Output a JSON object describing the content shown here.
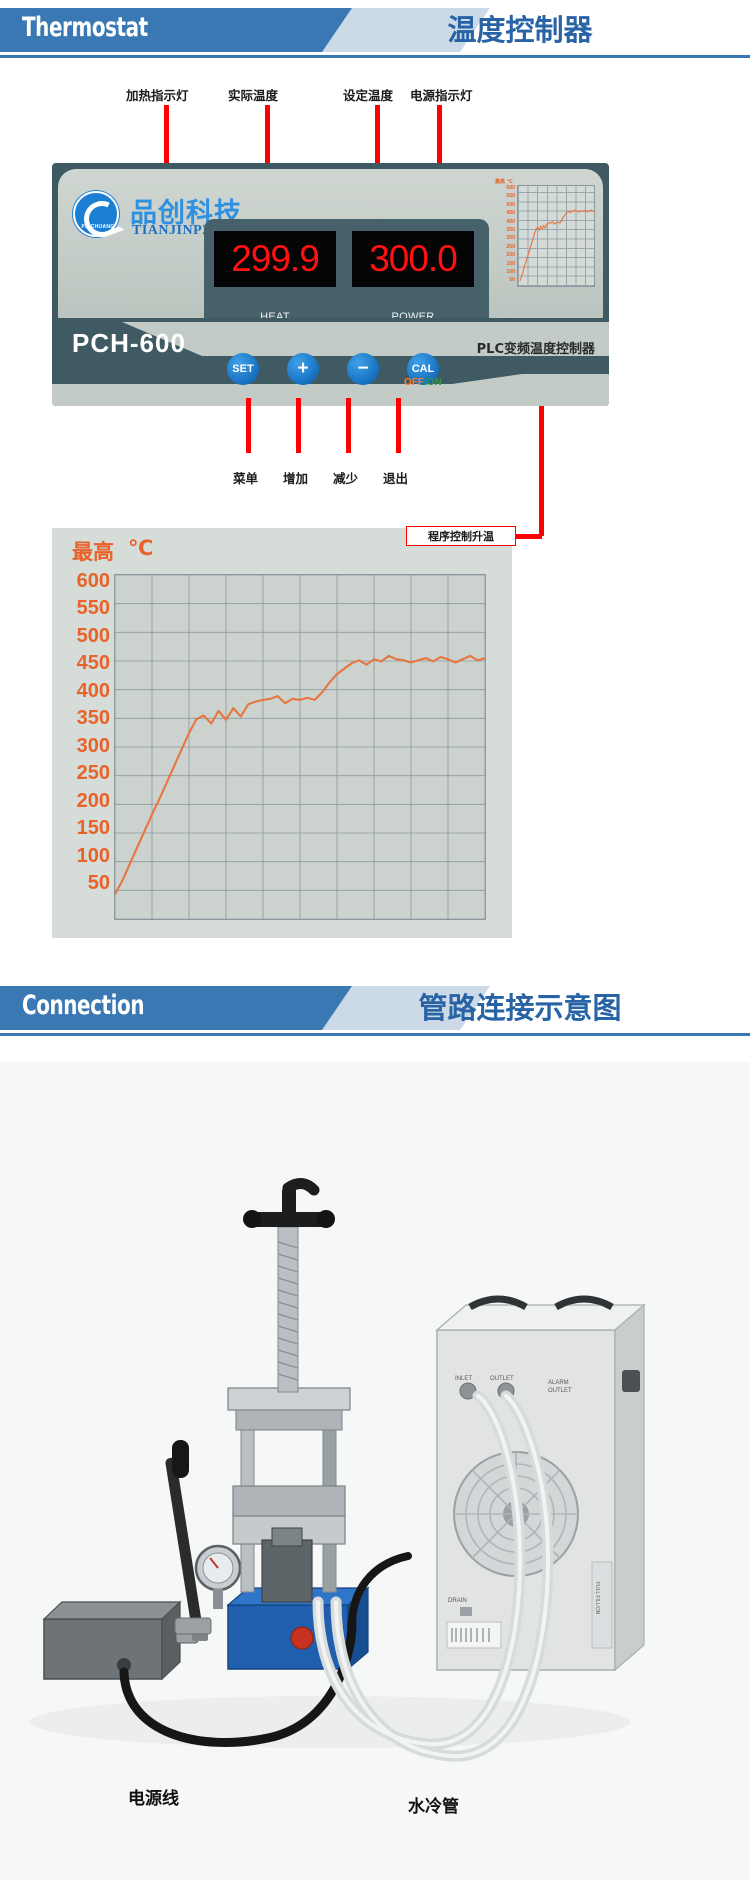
{
  "sections": [
    {
      "id": "thermostat",
      "en_title": "Thermostat",
      "cn_title": "温度控制器"
    },
    {
      "id": "connection",
      "en_title": "Connection",
      "cn_title": "管路连接示意图"
    }
  ],
  "top_callouts": [
    {
      "label": "加热指示灯"
    },
    {
      "label": "实际温度"
    },
    {
      "label": "设定温度"
    },
    {
      "label": "电源指示灯"
    }
  ],
  "bottom_callouts": [
    {
      "label": "菜单"
    },
    {
      "label": "增加"
    },
    {
      "label": "减少"
    },
    {
      "label": "退出"
    }
  ],
  "controller": {
    "brand_cn": "品创科技",
    "brand_domain": "TIANJINPZ.COM",
    "logo_text": "PINCHUANG",
    "model": "PCH-600",
    "tagline": "PLC变频温度控制器",
    "displays": [
      {
        "value": "299.9",
        "label": "HEAT"
      },
      {
        "value": "300.0",
        "label": "POWER"
      }
    ],
    "buttons": [
      {
        "label": "SET"
      },
      {
        "label": "+"
      },
      {
        "label": "−"
      },
      {
        "label": "CAL"
      }
    ],
    "power_switch": {
      "off": "OFF",
      "slash": "/",
      "on": "ON"
    },
    "mini_chart": {
      "title": "最高 ℃",
      "ticks": [
        "600",
        "550",
        "500",
        "450",
        "400",
        "350",
        "300",
        "250",
        "200",
        "150",
        "100",
        "50"
      ]
    }
  },
  "big_chart": {
    "callout": "程序控制升温",
    "title": "最高",
    "unit": "℃"
  },
  "chart_data": {
    "type": "line",
    "title": "最高 ℃",
    "xlabel": "",
    "ylabel": "℃",
    "ylim": [
      0,
      625
    ],
    "yticks": [
      600,
      550,
      500,
      450,
      400,
      350,
      300,
      250,
      200,
      150,
      100,
      50
    ],
    "ytick_labels": [
      "600",
      "550",
      "500",
      "450",
      "400",
      "350",
      "300",
      "250",
      "200",
      "150",
      "100",
      "50"
    ],
    "grid": true,
    "legend": "none",
    "line_color": "#e8743f",
    "series": [
      {
        "name": "程序控制升温",
        "x": [
          0,
          2,
          4,
          6,
          8,
          10,
          12,
          14,
          16,
          18,
          20,
          22,
          24,
          26,
          28,
          30,
          32,
          34,
          36,
          38,
          40,
          42,
          44,
          46,
          48,
          50,
          52,
          54,
          56,
          58,
          60,
          62,
          64,
          66,
          68,
          70,
          72,
          74,
          76,
          78,
          80,
          82,
          84,
          86,
          88,
          90,
          92,
          94,
          96,
          98,
          100
        ],
        "values": [
          45,
          70,
          100,
          130,
          160,
          190,
          218,
          248,
          278,
          308,
          338,
          363,
          370,
          355,
          378,
          362,
          383,
          368,
          390,
          395,
          398,
          400,
          405,
          392,
          400,
          398,
          402,
          398,
          412,
          430,
          445,
          455,
          465,
          470,
          462,
          472,
          468,
          478,
          472,
          470,
          466,
          470,
          474,
          468,
          476,
          472,
          466,
          472,
          478,
          470,
          474
        ]
      }
    ]
  },
  "photo": {
    "labels": [
      {
        "text": "电源线"
      },
      {
        "text": "水冷管"
      }
    ],
    "devices": {
      "chiller_ports": [
        "INLET",
        "OUTLET",
        "ALARM OUTLET",
        "DRAIN"
      ]
    }
  }
}
